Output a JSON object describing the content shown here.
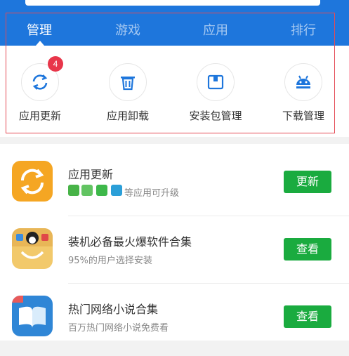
{
  "tabs": [
    {
      "label": "管理",
      "active": true
    },
    {
      "label": "游戏",
      "active": false
    },
    {
      "label": "应用",
      "active": false
    },
    {
      "label": "排行",
      "active": false
    }
  ],
  "tools": [
    {
      "label": "应用更新",
      "icon": "refresh-icon",
      "badge": "4"
    },
    {
      "label": "应用卸载",
      "icon": "trash-icon"
    },
    {
      "label": "安装包管理",
      "icon": "package-icon"
    },
    {
      "label": "下载管理",
      "icon": "android-icon"
    }
  ],
  "list": [
    {
      "title": "应用更新",
      "subtitle": "等应用可升级",
      "button": "更新",
      "icon": "refresh-app-icon"
    },
    {
      "title": "装机必备最火爆软件合集",
      "subtitle": "95%的用户选择安装",
      "button": "查看",
      "icon": "bag-app-icon"
    },
    {
      "title": "热门网络小说合集",
      "subtitle": "百万热门网络小说免费看",
      "button": "查看",
      "icon": "book-app-icon"
    }
  ],
  "colors": {
    "header": "#1e76dc",
    "accent": "#1e76dc",
    "button": "#1aab3f",
    "badge": "#e8364a",
    "highlight": "#e44a55"
  }
}
